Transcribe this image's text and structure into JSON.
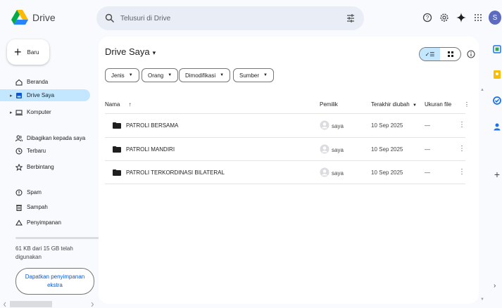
{
  "app": {
    "name": "Drive"
  },
  "search": {
    "placeholder": "Telusuri di Drive"
  },
  "sidebar": {
    "new_label": "Baru",
    "items": [
      {
        "label": "Beranda",
        "icon": "home-icon"
      },
      {
        "label": "Drive Saya",
        "icon": "my-drive-icon",
        "active": true
      },
      {
        "label": "Komputer",
        "icon": "computer-icon"
      },
      {
        "label": "Dibagikan kepada saya",
        "icon": "shared-icon"
      },
      {
        "label": "Terbaru",
        "icon": "clock-icon"
      },
      {
        "label": "Berbintang",
        "icon": "star-icon"
      },
      {
        "label": "Spam",
        "icon": "spam-icon"
      },
      {
        "label": "Sampah",
        "icon": "trash-icon"
      },
      {
        "label": "Penyimpanan",
        "icon": "cloud-icon"
      }
    ],
    "storage_text": "61 KB dari 15 GB telah digunakan",
    "storage_used_fraction": 0.01,
    "get_storage_label": "Dapatkan penyimpanan ekstra"
  },
  "main": {
    "title": "Drive Saya",
    "filters": [
      "Jenis",
      "Orang",
      "Dimodifikasi",
      "Sumber"
    ],
    "columns": {
      "name": "Nama",
      "owner": "Pemilik",
      "modified": "Terakhir diubah",
      "size": "Ukuran file"
    },
    "rows": [
      {
        "name": "PATROLI BERSAMA",
        "owner": "saya",
        "modified": "10 Sep 2025",
        "size": "—"
      },
      {
        "name": "PATROLI MANDIRI",
        "owner": "saya",
        "modified": "10 Sep 2025",
        "size": "—"
      },
      {
        "name": "PATROLI TERKORDINASI BILATERAL",
        "owner": "saya",
        "modified": "10 Sep 2025",
        "size": "—"
      }
    ]
  },
  "account": {
    "initial": "S",
    "color": "#5c6bc0"
  },
  "colors": {
    "accent": "#0b57d0",
    "active_nav": "#c2e7ff",
    "background": "#f8fafd"
  }
}
